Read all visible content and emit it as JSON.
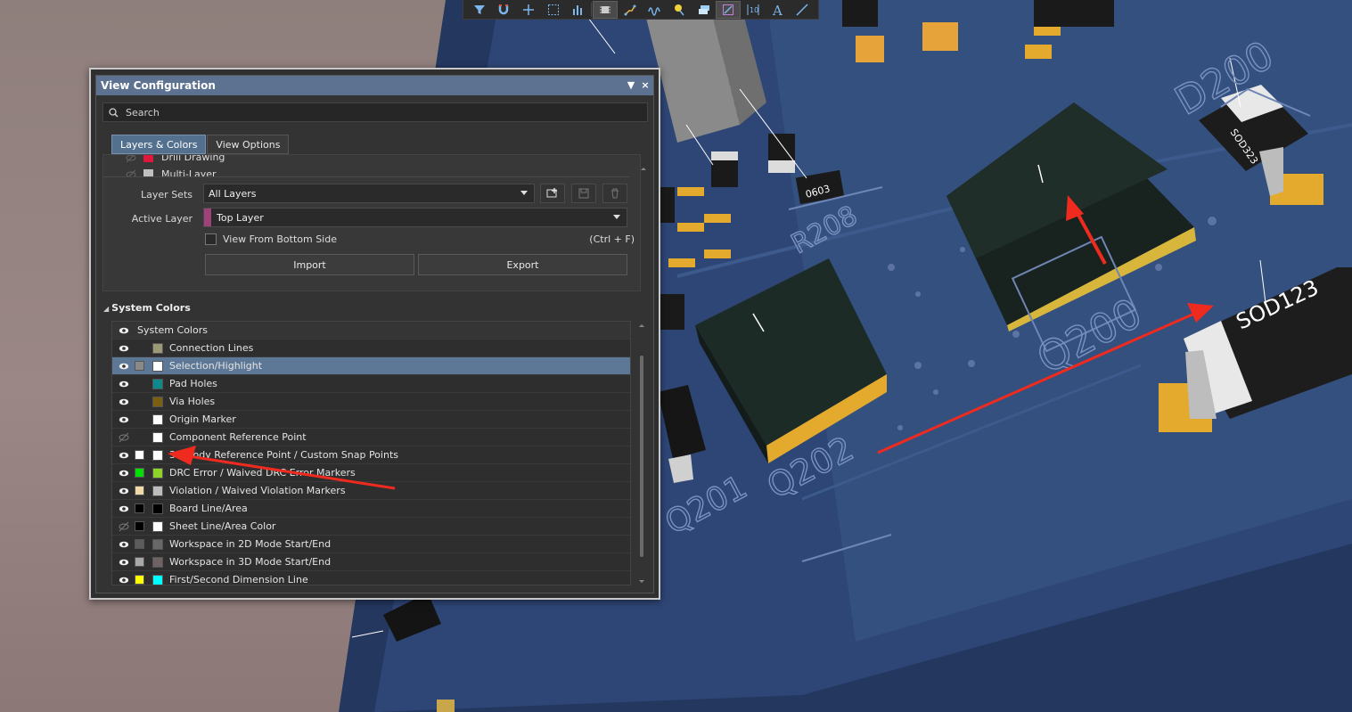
{
  "toolbar": {
    "icons": [
      "filter-icon",
      "magnet-icon",
      "plus-icon",
      "select-rect-icon",
      "bar-chart-icon",
      "component-icon",
      "route-icon",
      "wave-icon",
      "pin-icon",
      "layers-icon",
      "highlight-icon",
      "dimension-icon",
      "text-icon",
      "line-icon"
    ]
  },
  "pcb": {
    "labels": [
      "D200",
      "SOD123",
      "Q200",
      "Q202",
      "Q201",
      "R208",
      "SOD323",
      "0603"
    ]
  },
  "panel": {
    "title": "View Configuration",
    "menu_glyph": "▼",
    "close_glyph": "×",
    "search_placeholder": "Search",
    "tabs": [
      {
        "label": "Layers & Colors",
        "active": true
      },
      {
        "label": "View Options",
        "active": false
      }
    ],
    "layers_partial": [
      {
        "name": "Drill Drawing",
        "color": "#e0173c"
      },
      {
        "name": "Multi-Layer",
        "color": "#c0c0c0"
      }
    ],
    "layer_sets_label": "Layer Sets",
    "layer_sets_value": "All Layers",
    "active_layer_label": "Active Layer",
    "active_layer_value": "Top Layer",
    "active_layer_color": "#a0427a",
    "view_bottom_label": "View From Bottom Side",
    "view_bottom_shortcut": "(Ctrl + F)",
    "import_label": "Import",
    "export_label": "Export",
    "system_colors_section": "System Colors",
    "system_colors_header": "System Colors",
    "system_colors": [
      {
        "name": "Connection Lines",
        "visible": true,
        "sw1": null,
        "sw2": "#9c9a76",
        "selected": false
      },
      {
        "name": "Selection/Highlight",
        "visible": true,
        "sw1": "#8a8a8a",
        "sw2": "#ffffff",
        "selected": true
      },
      {
        "name": "Pad Holes",
        "visible": true,
        "sw1": null,
        "sw2": "#0f8a8c",
        "selected": false
      },
      {
        "name": "Via Holes",
        "visible": true,
        "sw1": null,
        "sw2": "#7a5e12",
        "selected": false
      },
      {
        "name": "Origin Marker",
        "visible": true,
        "sw1": null,
        "sw2": "#ffffff",
        "selected": false
      },
      {
        "name": "Component Reference Point",
        "visible": false,
        "sw1": null,
        "sw2": "#ffffff",
        "selected": false
      },
      {
        "name": "3D Body Reference Point / Custom Snap Points",
        "visible": true,
        "sw1": "#ffffff",
        "sw2": "#ffffff",
        "selected": false
      },
      {
        "name": "DRC Error / Waived DRC Error Markers",
        "visible": true,
        "sw1": "#00e000",
        "sw2": "#8fd32a",
        "selected": false
      },
      {
        "name": "Violation / Waived Violation Markers",
        "visible": true,
        "sw1": "#f1d9a8",
        "sw2": "#bdbdbd",
        "selected": false
      },
      {
        "name": "Board Line/Area",
        "visible": true,
        "sw1": "#000000",
        "sw2": "#000000",
        "selected": false
      },
      {
        "name": "Sheet Line/Area Color",
        "visible": false,
        "sw1": "#000000",
        "sw2": "#ffffff",
        "selected": false
      },
      {
        "name": "Workspace in 2D Mode Start/End",
        "visible": true,
        "sw1": "#5c5c5c",
        "sw2": "#6a6767",
        "selected": false
      },
      {
        "name": "Workspace in 3D Mode Start/End",
        "visible": true,
        "sw1": "#a8a8a8",
        "sw2": "#6f6263",
        "selected": false
      },
      {
        "name": "First/Second Dimension Line",
        "visible": true,
        "sw1": "#ffff00",
        "sw2": "#00ffff",
        "selected": false
      }
    ]
  }
}
